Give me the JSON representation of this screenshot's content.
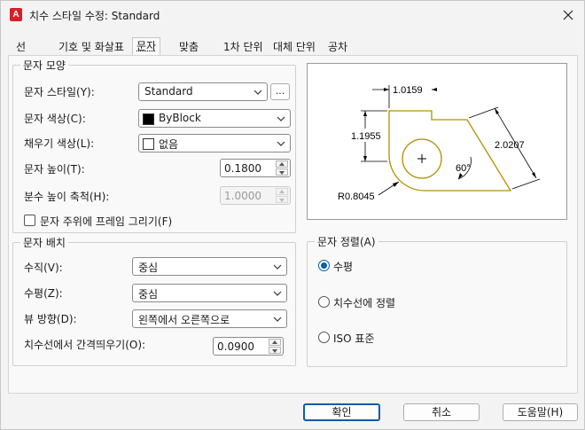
{
  "window": {
    "title": "치수 스타일 수정: Standard",
    "app_icon_letter": "A",
    "accent_color": "#0b5cad",
    "icon_color": "#d3212b"
  },
  "tabs": [
    {
      "label": "선"
    },
    {
      "label": "기호 및 화살표"
    },
    {
      "label": "문자",
      "active": true
    },
    {
      "label": "맞춤"
    },
    {
      "label": "1차 단위"
    },
    {
      "label": "대체 단위"
    },
    {
      "label": "공차"
    }
  ],
  "text_appearance": {
    "group_label": "문자 모양",
    "style_label": "문자 스타일(Y):",
    "style_value": "Standard",
    "style_browse_label": "...",
    "color_label": "문자 색상(C):",
    "color_value": "ByBlock",
    "fill_label": "채우기 색상(L):",
    "fill_value": "없음",
    "height_label": "문자 높이(T):",
    "height_value": "0.1800",
    "fraction_label": "분수 높이 축척(H):",
    "fraction_value": "1.0000",
    "frame_label": "문자 주위에 프레임 그리기(F)",
    "frame_checked": false
  },
  "text_placement": {
    "group_label": "문자 배치",
    "vertical_label": "수직(V):",
    "vertical_value": "중심",
    "horizontal_label": "수평(Z):",
    "horizontal_value": "중심",
    "view_dir_label": "뷰 방향(D):",
    "view_dir_value": "왼쪽에서 오른쪽으로",
    "offset_label": "치수선에서 간격띄우기(O):",
    "offset_value": "0.0900"
  },
  "text_alignment": {
    "group_label": "문자 정렬(A)",
    "options": [
      {
        "label": "수평",
        "selected": true
      },
      {
        "label": "치수선에 정렬",
        "selected": false
      },
      {
        "label": "ISO 표준",
        "selected": false
      }
    ]
  },
  "preview": {
    "dim_top": "1.0159",
    "dim_left": "1.1955",
    "dim_diag": "2.0207",
    "dim_angle": "60°",
    "dim_radius": "R0.8045",
    "part_color": "#b59000"
  },
  "buttons": {
    "ok": "확인",
    "cancel": "취소",
    "help": "도움말(H)"
  }
}
